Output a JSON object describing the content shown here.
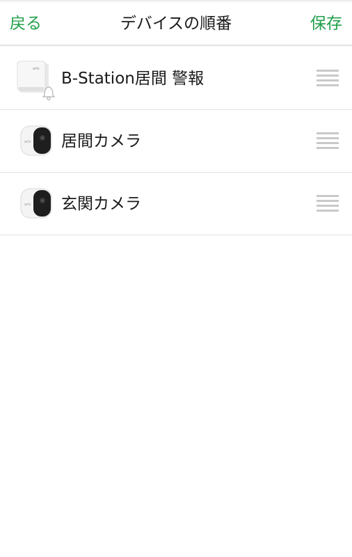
{
  "header": {
    "back_label": "戻る",
    "title": "デバイスの順番",
    "save_label": "保存"
  },
  "devices": [
    {
      "name": "B-Station居間 警報",
      "icon": "base-station-icon",
      "brand": "arlo"
    },
    {
      "name": "居間カメラ",
      "icon": "camera-icon",
      "brand": "arlo"
    },
    {
      "name": "玄関カメラ",
      "icon": "camera-icon",
      "brand": "arlo"
    }
  ],
  "colors": {
    "accent": "#22a04b",
    "divider": "#e2e2e2",
    "handle": "#c9c9c9"
  }
}
